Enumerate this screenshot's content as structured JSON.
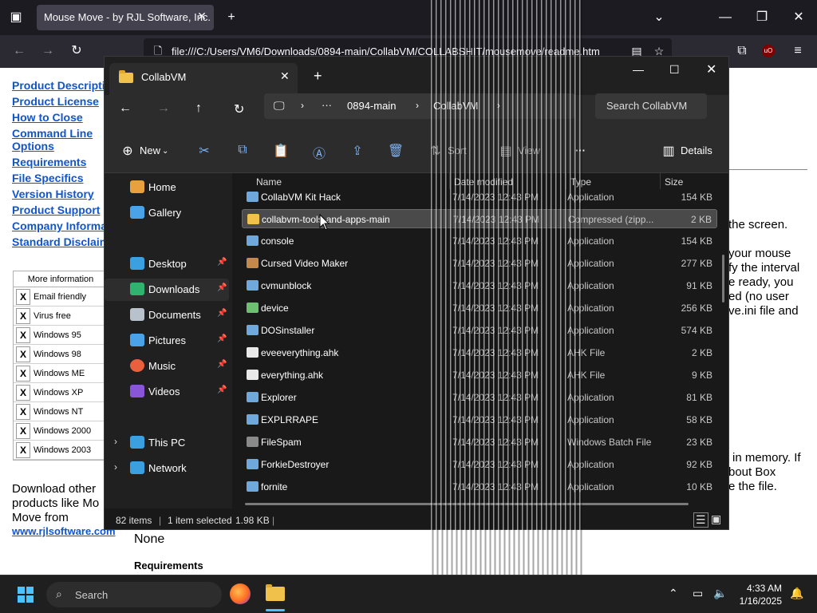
{
  "browser": {
    "tab_title": "Mouse Move - by RJL Software, Inc.",
    "url": "file:///C:/Users/VM6/Downloads/0894-main/CollabVM/COLLABSHIT/mousemove/readme.htm",
    "ublock_label": "uO"
  },
  "webpage": {
    "nav_links": [
      "Product Description",
      "Product License",
      "How to Close",
      "Command Line",
      "Options",
      "Requirements",
      "File Specifics",
      "Version History",
      "Product Support",
      "Company Information",
      "Standard Disclaimer"
    ],
    "info_table": {
      "header": "More information",
      "mark": "X",
      "rows": [
        "Email friendly",
        "Virus free",
        "Windows 95",
        "Windows 98",
        "Windows ME",
        "Windows XP",
        "Windows NT",
        "Windows 2000",
        "Windows 2003"
      ]
    },
    "download_text": [
      "Download other",
      "products like Mo",
      "Move from"
    ],
    "download_link": "www.rjlsoftware.com",
    "right_fragments": [
      "the screen.",
      "your mouse",
      "fy the interval",
      "e ready, you",
      "ed (no user",
      "ve.ini file and",
      "in memory. If",
      "bout Box",
      "e the file."
    ],
    "none_text": "None",
    "requirements_heading": "Requirements"
  },
  "explorer": {
    "tab_title": "CollabVM",
    "breadcrumb": [
      "0894-main",
      "CollabVM"
    ],
    "breadcrumb_more": "···",
    "search_placeholder": "Search CollabVM",
    "commands": {
      "new": "New",
      "sort": "Sort",
      "view": "View",
      "more": "···",
      "details": "Details"
    },
    "sidebar": [
      {
        "label": "Home",
        "icon": "home-icon",
        "color": "#e8a13c"
      },
      {
        "label": "Gallery",
        "icon": "gallery-icon",
        "color": "#4aa3e8"
      },
      {
        "label": "Desktop",
        "icon": "desktop-icon",
        "color": "#3aa0e0"
      },
      {
        "label": "Downloads",
        "icon": "downloads-icon",
        "color": "#2fb36f"
      },
      {
        "label": "Documents",
        "icon": "documents-icon",
        "color": "#b8c2cc"
      },
      {
        "label": "Pictures",
        "icon": "pictures-icon",
        "color": "#4aa3e8"
      },
      {
        "label": "Music",
        "icon": "music-icon",
        "color": "#e8613c"
      },
      {
        "label": "Videos",
        "icon": "videos-icon",
        "color": "#8a55d8"
      },
      {
        "label": "This PC",
        "icon": "this-pc-icon",
        "color": "#3aa0e0"
      },
      {
        "label": "Network",
        "icon": "network-icon",
        "color": "#3aa0e0"
      }
    ],
    "columns": [
      "Name",
      "Date modified",
      "Type",
      "Size"
    ],
    "files": [
      {
        "name": "CollabVM Kit Hack",
        "date": "7/14/2023 12:43 PM",
        "type": "Application",
        "size": "154 KB",
        "icon_color": "#6fa8dc"
      },
      {
        "name": "collabvm-tools-and-apps-main",
        "date": "7/14/2023 12:43 PM",
        "type": "Compressed (zipp...",
        "size": "2 KB",
        "icon_color": "#f0c14b"
      },
      {
        "name": "console",
        "date": "7/14/2023 12:43 PM",
        "type": "Application",
        "size": "154 KB",
        "icon_color": "#6fa8dc"
      },
      {
        "name": "Cursed Video Maker",
        "date": "7/14/2023 12:43 PM",
        "type": "Application",
        "size": "277 KB",
        "icon_color": "#c58a4a"
      },
      {
        "name": "cvmunblock",
        "date": "7/14/2023 12:43 PM",
        "type": "Application",
        "size": "91 KB",
        "icon_color": "#6fa8dc"
      },
      {
        "name": "device",
        "date": "7/14/2023 12:43 PM",
        "type": "Application",
        "size": "256 KB",
        "icon_color": "#6cc070"
      },
      {
        "name": "DOSinstaller",
        "date": "7/14/2023 12:43 PM",
        "type": "Application",
        "size": "574 KB",
        "icon_color": "#6fa8dc"
      },
      {
        "name": "eveeverything.ahk",
        "date": "7/14/2023 12:43 PM",
        "type": "AHK File",
        "size": "2 KB",
        "icon_color": "#e8e8e8"
      },
      {
        "name": "everything.ahk",
        "date": "7/14/2023 12:43 PM",
        "type": "AHK File",
        "size": "9 KB",
        "icon_color": "#e8e8e8"
      },
      {
        "name": "Explorer",
        "date": "7/14/2023 12:43 PM",
        "type": "Application",
        "size": "81 KB",
        "icon_color": "#6fa8dc"
      },
      {
        "name": "EXPLRRAPE",
        "date": "7/14/2023 12:43 PM",
        "type": "Application",
        "size": "58 KB",
        "icon_color": "#6fa8dc"
      },
      {
        "name": "FileSpam",
        "date": "7/14/2023 12:43 PM",
        "type": "Windows Batch File",
        "size": "23 KB",
        "icon_color": "#8a8a8a"
      },
      {
        "name": "ForkieDestroyer",
        "date": "7/14/2023 12:43 PM",
        "type": "Application",
        "size": "92 KB",
        "icon_color": "#6fa8dc"
      },
      {
        "name": "fornite",
        "date": "7/14/2023 12:43 PM",
        "type": "Application",
        "size": "10 KB",
        "icon_color": "#6fa8dc"
      }
    ],
    "status": {
      "items": "82 items",
      "selected": "1 item selected",
      "size": "1.98 KB"
    }
  },
  "taskbar": {
    "search_placeholder": "Search",
    "time": "4:33 AM",
    "date": "1/16/2025"
  }
}
